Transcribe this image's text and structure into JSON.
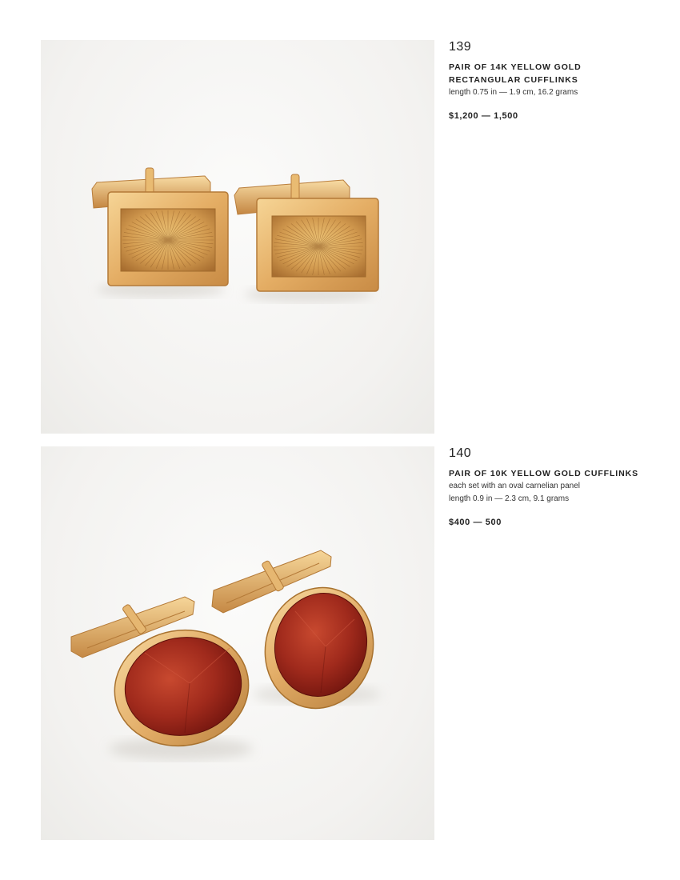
{
  "colors": {
    "gold_light": "#f2cc85",
    "gold_mid": "#dfa860",
    "gold_dark": "#b97e3d",
    "carnelian_light": "#c24430",
    "carnelian_dark": "#7a1610",
    "photo_background": "#f3f2f0"
  },
  "lots": [
    {
      "number": "139",
      "title_line1": "PAIR OF 14K YELLOW GOLD",
      "title_line2": "RECTANGULAR CUFFLINKS",
      "description_lines": [
        "length 0.75 in — 1.9 cm, 16.2 grams"
      ],
      "estimate": "$1,200 — 1,500",
      "image": "rectangular-gold-cufflinks"
    },
    {
      "number": "140",
      "title_line1": "PAIR OF 10K YELLOW GOLD CUFFLINKS",
      "title_line2": "",
      "description_lines": [
        "each set with an oval carnelian panel",
        "length 0.9 in — 2.3 cm, 9.1 grams"
      ],
      "estimate": "$400 — 500",
      "image": "oval-carnelian-cufflinks"
    }
  ]
}
